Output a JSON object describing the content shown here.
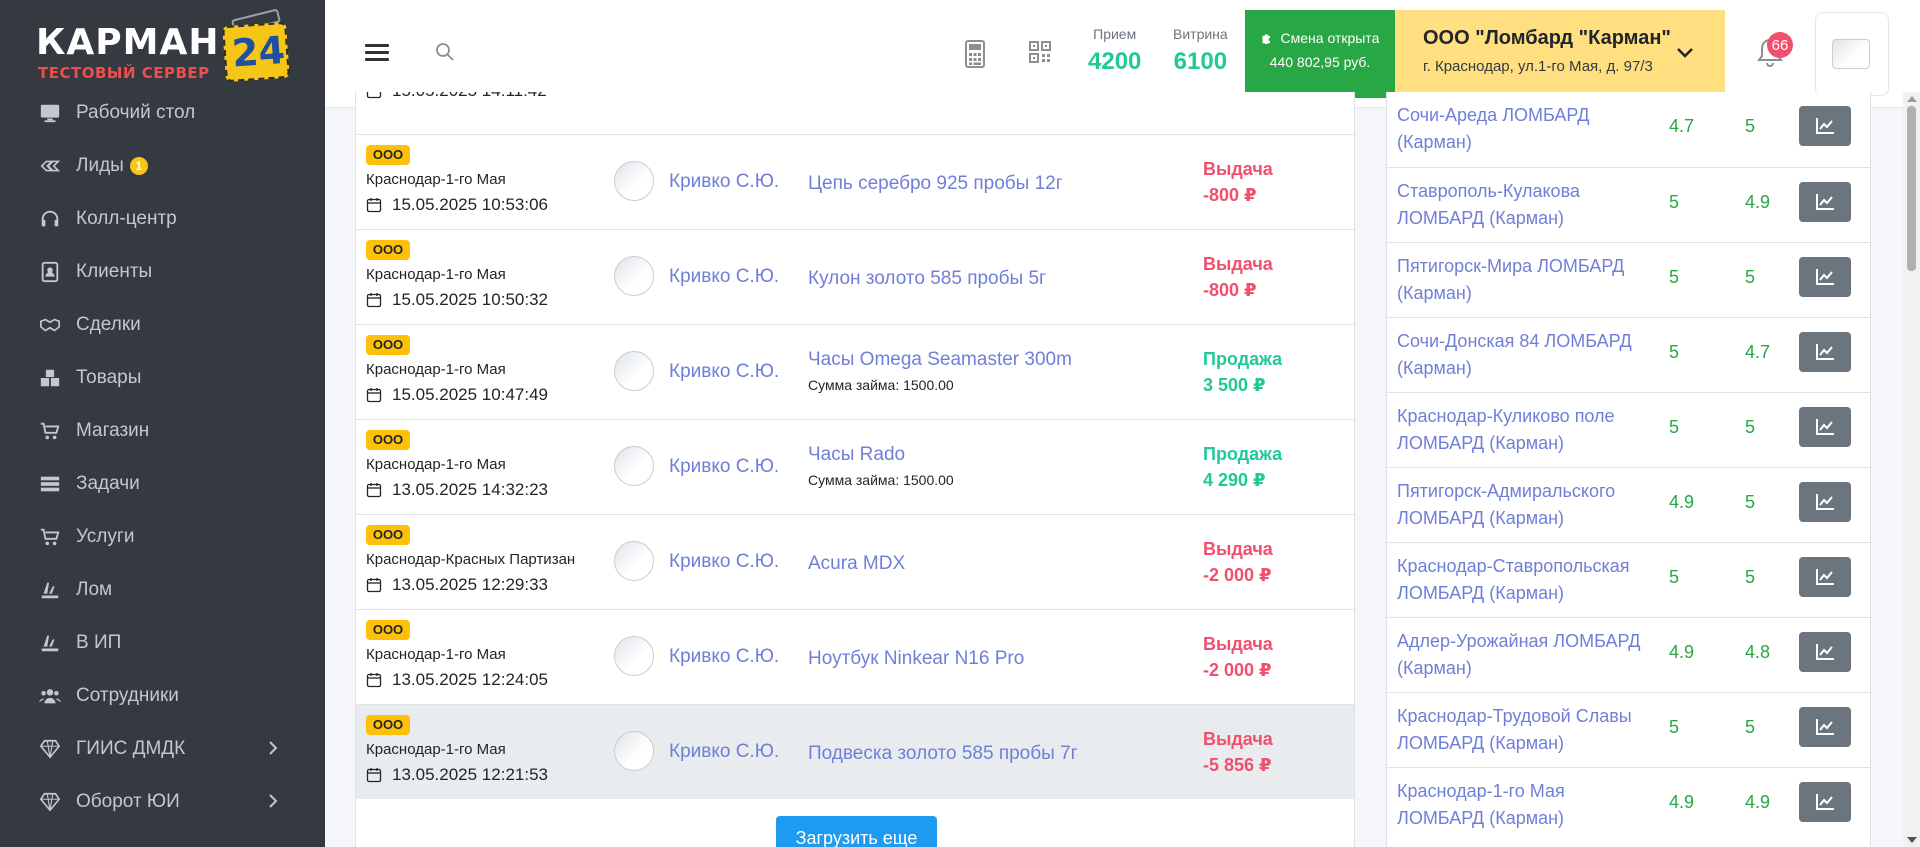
{
  "logo": {
    "brand": "КАРМАН",
    "badge": "24",
    "subtitle": "ТЕСТОВЫЙ СЕРВЕР"
  },
  "sidebar": {
    "items": [
      {
        "label": "Рабочий стол",
        "icon": "desktop-icon"
      },
      {
        "label": "Лиды",
        "icon": "leads-icon",
        "badge": "1"
      },
      {
        "label": "Колл-центр",
        "icon": "headset-icon"
      },
      {
        "label": "Клиенты",
        "icon": "contacts-icon"
      },
      {
        "label": "Сделки",
        "icon": "handshake-icon"
      },
      {
        "label": "Товары",
        "icon": "boxes-icon"
      },
      {
        "label": "Магазин",
        "icon": "cart-icon"
      },
      {
        "label": "Задачи",
        "icon": "tasks-icon"
      },
      {
        "label": "Услуги",
        "icon": "cart-icon"
      },
      {
        "label": "Лом",
        "icon": "scrap-icon"
      },
      {
        "label": "В ИП",
        "icon": "scrap-icon"
      },
      {
        "label": "Сотрудники",
        "icon": "users-icon"
      },
      {
        "label": "ГИИС ДМДК",
        "icon": "gem-icon",
        "expandable": true
      },
      {
        "label": "Оборот ЮИ",
        "icon": "gem-icon",
        "expandable": true
      }
    ]
  },
  "header": {
    "stats": [
      {
        "label": "Прием",
        "value": "4200"
      },
      {
        "label": "Витрина",
        "value": "6100"
      }
    ],
    "shift": {
      "title": "Смена открыта",
      "amount": "440 802,95 руб."
    },
    "org": {
      "name": "ООО \"Ломбард \"Карман\"",
      "address": "г. Краснодар, ул.1-го Мая, д. 97/3"
    },
    "notifications": "66"
  },
  "feed": {
    "partial_row_date": "15.05.2025 14:11:42",
    "rows": [
      {
        "org": "ООО",
        "city": "Краснодар-1-го Мая",
        "datetime": "15.05.2025 10:53:06",
        "employee": "Кривко С.Ю.",
        "item": "Цепь серебро 925 пробы 12г",
        "loan": "",
        "operation": "Выдача",
        "amount": "-800 ₽",
        "kind": "issue"
      },
      {
        "org": "ООО",
        "city": "Краснодар-1-го Мая",
        "datetime": "15.05.2025 10:50:32",
        "employee": "Кривко С.Ю.",
        "item": "Кулон золото 585 пробы 5г",
        "loan": "",
        "operation": "Выдача",
        "amount": "-800 ₽",
        "kind": "issue"
      },
      {
        "org": "ООО",
        "city": "Краснодар-1-го Мая",
        "datetime": "15.05.2025 10:47:49",
        "employee": "Кривко С.Ю.",
        "item": "Часы Omega Seamaster 300m",
        "loan": "Сумма займа: 1500.00",
        "operation": "Продажа",
        "amount": "3 500 ₽",
        "kind": "sale"
      },
      {
        "org": "ООО",
        "city": "Краснодар-1-го Мая",
        "datetime": "13.05.2025 14:32:23",
        "employee": "Кривко С.Ю.",
        "item": "Часы Rado",
        "loan": "Сумма займа: 1500.00",
        "operation": "Продажа",
        "amount": "4 290 ₽",
        "kind": "sale"
      },
      {
        "org": "ООО",
        "city": "Краснодар-Красных Партизан",
        "datetime": "13.05.2025 12:29:33",
        "employee": "Кривко С.Ю.",
        "item": "Acura MDX",
        "loan": "",
        "operation": "Выдача",
        "amount": "-2 000 ₽",
        "kind": "issue"
      },
      {
        "org": "ООО",
        "city": "Краснодар-1-го Мая",
        "datetime": "13.05.2025 12:24:05",
        "employee": "Кривко С.Ю.",
        "item": "Ноутбук Ninkear N16 Pro",
        "loan": "",
        "operation": "Выдача",
        "amount": "-2 000 ₽",
        "kind": "issue"
      },
      {
        "org": "ООО",
        "city": "Краснодар-1-го Мая",
        "datetime": "13.05.2025 12:21:53",
        "employee": "Кривко С.Ю.",
        "item": "Подвеска золото 585 пробы 7г",
        "loan": "",
        "operation": "Выдача",
        "amount": "-5 856 ₽",
        "kind": "issue",
        "highlighted": true
      }
    ],
    "load_more": "Загрузить еще"
  },
  "ratings": [
    {
      "name": "Сочи-Ареда ЛОМБАРД (Карман)",
      "r1": "4.7",
      "r2": "5"
    },
    {
      "name": "Ставрополь-Кулакова ЛОМБАРД (Карман)",
      "r1": "5",
      "r2": "4.9"
    },
    {
      "name": "Пятигорск-Мира ЛОМБАРД (Карман)",
      "r1": "5",
      "r2": "5"
    },
    {
      "name": "Сочи-Донская 84 ЛОМБАРД (Карман)",
      "r1": "5",
      "r2": "4.7"
    },
    {
      "name": "Краснодар-Куликово поле ЛОМБАРД (Карман)",
      "r1": "5",
      "r2": "5"
    },
    {
      "name": "Пятигорск-Адмиральского ЛОМБАРД (Карман)",
      "r1": "4.9",
      "r2": "5"
    },
    {
      "name": "Краснодар-Ставропольская ЛОМБАРД (Карман)",
      "r1": "5",
      "r2": "5"
    },
    {
      "name": "Адлер-Урожайная ЛОМБАРД (Карман)",
      "r1": "4.9",
      "r2": "4.8"
    },
    {
      "name": "Краснодар-Трудовой Славы ЛОМБАРД (Карман)",
      "r1": "5",
      "r2": "5"
    },
    {
      "name": "Краснодар-1-го Мая ЛОМБАРД (Карман)",
      "r1": "4.9",
      "r2": "4.9"
    }
  ],
  "colors": {
    "sidebar": "#343a40",
    "shift": "#28a745",
    "org": "#ffdf80",
    "badge": "#ffc107",
    "issue": "#f0506e",
    "sale": "#20c997",
    "link": "#6f7fd8"
  }
}
